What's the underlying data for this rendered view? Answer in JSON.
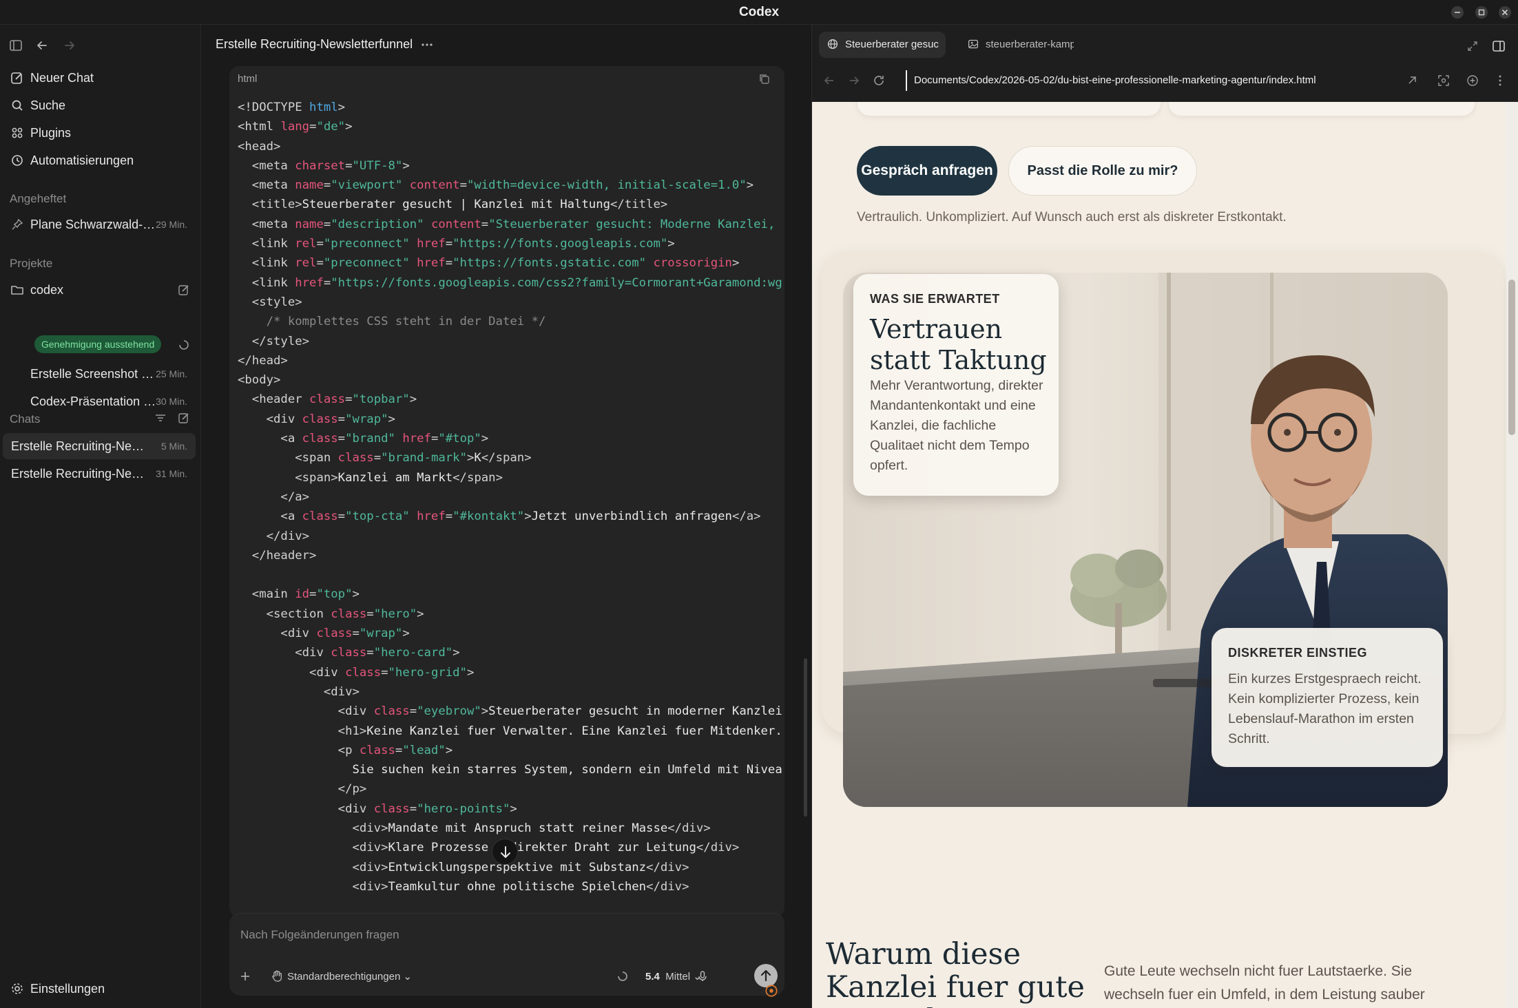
{
  "app": {
    "title": "Codex"
  },
  "sidebar": {
    "nav": [
      {
        "label": "Neuer Chat",
        "icon": "new-chat-icon"
      },
      {
        "label": "Suche",
        "icon": "search-icon"
      },
      {
        "label": "Plugins",
        "icon": "plugins-icon"
      },
      {
        "label": "Automatisierungen",
        "icon": "clock-icon"
      }
    ],
    "pinned_heading": "Angeheftet",
    "pinned": [
      {
        "label": "Plane Schwarzwald-…",
        "time": "29 Min."
      }
    ],
    "projects_heading": "Projekte",
    "project": {
      "label": "codex",
      "badge": "Genehmigung ausstehend"
    },
    "project_items": [
      {
        "label": "Erstelle Screenshot …",
        "time": "25 Min."
      },
      {
        "label": "Codex-Präsentation …",
        "time": "30 Min."
      }
    ],
    "chats_heading": "Chats",
    "chats": [
      {
        "label": "Erstelle Recruiting-Ne…",
        "time": "5 Min."
      },
      {
        "label": "Erstelle Recruiting-Ne…",
        "time": "31 Min."
      }
    ],
    "settings_label": "Einstellungen"
  },
  "chat": {
    "title": "Erstelle Recruiting-Newsletterfunnel",
    "code_lang": "html",
    "composer_placeholder": "Nach Folgeänderungen fragen",
    "permissions_label": "Standardberechtigungen",
    "model_label": "5.4",
    "effort_label": "Mittel"
  },
  "code_lines": [
    [
      [
        "p",
        "<!DOCTYPE "
      ],
      [
        "k",
        "html"
      ],
      [
        "p",
        ">"
      ]
    ],
    [
      [
        "p",
        "<html "
      ],
      [
        "a",
        "lang"
      ],
      [
        "p",
        "="
      ],
      [
        "s",
        "\"de\""
      ],
      [
        "p",
        ">"
      ]
    ],
    [
      [
        "p",
        "<head>"
      ]
    ],
    [
      [
        "p",
        "  <meta "
      ],
      [
        "a",
        "charset"
      ],
      [
        "p",
        "="
      ],
      [
        "s",
        "\"UTF-8\""
      ],
      [
        "p",
        ">"
      ]
    ],
    [
      [
        "p",
        "  <meta "
      ],
      [
        "a",
        "name"
      ],
      [
        "p",
        "="
      ],
      [
        "s",
        "\"viewport\""
      ],
      [
        "p",
        " "
      ],
      [
        "a",
        "content"
      ],
      [
        "p",
        "="
      ],
      [
        "s",
        "\"width=device-width, initial-scale=1.0\""
      ],
      [
        "p",
        ">"
      ]
    ],
    [
      [
        "p",
        "  <title>"
      ],
      [
        "t",
        "Steuerberater gesucht | Kanzlei mit Haltung"
      ],
      [
        "p",
        "</title>"
      ]
    ],
    [
      [
        "p",
        "  <meta "
      ],
      [
        "a",
        "name"
      ],
      [
        "p",
        "="
      ],
      [
        "s",
        "\"description\""
      ],
      [
        "p",
        " "
      ],
      [
        "a",
        "content"
      ],
      [
        "p",
        "="
      ],
      [
        "s",
        "\"Steuerberater gesucht: Moderne Kanzlei,"
      ]
    ],
    [
      [
        "p",
        "  <link "
      ],
      [
        "a",
        "rel"
      ],
      [
        "p",
        "="
      ],
      [
        "s",
        "\"preconnect\""
      ],
      [
        "p",
        " "
      ],
      [
        "a",
        "href"
      ],
      [
        "p",
        "="
      ],
      [
        "s",
        "\"https://fonts.googleapis.com\""
      ],
      [
        "p",
        ">"
      ]
    ],
    [
      [
        "p",
        "  <link "
      ],
      [
        "a",
        "rel"
      ],
      [
        "p",
        "="
      ],
      [
        "s",
        "\"preconnect\""
      ],
      [
        "p",
        " "
      ],
      [
        "a",
        "href"
      ],
      [
        "p",
        "="
      ],
      [
        "s",
        "\"https://fonts.gstatic.com\""
      ],
      [
        "p",
        " "
      ],
      [
        "a",
        "crossorigin"
      ],
      [
        "p",
        ">"
      ]
    ],
    [
      [
        "p",
        "  <link "
      ],
      [
        "a",
        "href"
      ],
      [
        "p",
        "="
      ],
      [
        "s",
        "\"https://fonts.googleapis.com/css2?family=Cormorant+Garamond:wg"
      ]
    ],
    [
      [
        "p",
        "  <style>"
      ]
    ],
    [
      [
        "c",
        "    /* komplettes CSS steht in der Datei */"
      ]
    ],
    [
      [
        "p",
        "  </style>"
      ]
    ],
    [
      [
        "p",
        "</head>"
      ]
    ],
    [
      [
        "p",
        "<body>"
      ]
    ],
    [
      [
        "p",
        "  <header "
      ],
      [
        "a",
        "class"
      ],
      [
        "p",
        "="
      ],
      [
        "s",
        "\"topbar\""
      ],
      [
        "p",
        ">"
      ]
    ],
    [
      [
        "p",
        "    <div "
      ],
      [
        "a",
        "class"
      ],
      [
        "p",
        "="
      ],
      [
        "s",
        "\"wrap\""
      ],
      [
        "p",
        ">"
      ]
    ],
    [
      [
        "p",
        "      <a "
      ],
      [
        "a",
        "class"
      ],
      [
        "p",
        "="
      ],
      [
        "s",
        "\"brand\""
      ],
      [
        "p",
        " "
      ],
      [
        "a",
        "href"
      ],
      [
        "p",
        "="
      ],
      [
        "s",
        "\"#top\""
      ],
      [
        "p",
        ">"
      ]
    ],
    [
      [
        "p",
        "        <span "
      ],
      [
        "a",
        "class"
      ],
      [
        "p",
        "="
      ],
      [
        "s",
        "\"brand-mark\""
      ],
      [
        "p",
        ">"
      ],
      [
        "t",
        "K"
      ],
      [
        "p",
        "</span>"
      ]
    ],
    [
      [
        "p",
        "        <span>"
      ],
      [
        "t",
        "Kanzlei am Markt"
      ],
      [
        "p",
        "</span>"
      ]
    ],
    [
      [
        "p",
        "      </a>"
      ]
    ],
    [
      [
        "p",
        "      <a "
      ],
      [
        "a",
        "class"
      ],
      [
        "p",
        "="
      ],
      [
        "s",
        "\"top-cta\""
      ],
      [
        "p",
        " "
      ],
      [
        "a",
        "href"
      ],
      [
        "p",
        "="
      ],
      [
        "s",
        "\"#kontakt\""
      ],
      [
        "p",
        ">"
      ],
      [
        "t",
        "Jetzt unverbindlich anfragen"
      ],
      [
        "p",
        "</a>"
      ]
    ],
    [
      [
        "p",
        "    </div>"
      ]
    ],
    [
      [
        "p",
        "  </header>"
      ]
    ],
    [
      [
        "p",
        ""
      ]
    ],
    [
      [
        "p",
        "  <main "
      ],
      [
        "a",
        "id"
      ],
      [
        "p",
        "="
      ],
      [
        "s",
        "\"top\""
      ],
      [
        "p",
        ">"
      ]
    ],
    [
      [
        "p",
        "    <section "
      ],
      [
        "a",
        "class"
      ],
      [
        "p",
        "="
      ],
      [
        "s",
        "\"hero\""
      ],
      [
        "p",
        ">"
      ]
    ],
    [
      [
        "p",
        "      <div "
      ],
      [
        "a",
        "class"
      ],
      [
        "p",
        "="
      ],
      [
        "s",
        "\"wrap\""
      ],
      [
        "p",
        ">"
      ]
    ],
    [
      [
        "p",
        "        <div "
      ],
      [
        "a",
        "class"
      ],
      [
        "p",
        "="
      ],
      [
        "s",
        "\"hero-card\""
      ],
      [
        "p",
        ">"
      ]
    ],
    [
      [
        "p",
        "          <div "
      ],
      [
        "a",
        "class"
      ],
      [
        "p",
        "="
      ],
      [
        "s",
        "\"hero-grid\""
      ],
      [
        "p",
        ">"
      ]
    ],
    [
      [
        "p",
        "            <div>"
      ]
    ],
    [
      [
        "p",
        "              <div "
      ],
      [
        "a",
        "class"
      ],
      [
        "p",
        "="
      ],
      [
        "s",
        "\"eyebrow\""
      ],
      [
        "p",
        ">"
      ],
      [
        "t",
        "Steuerberater gesucht in moderner Kanzlei"
      ]
    ],
    [
      [
        "p",
        "              <h1>"
      ],
      [
        "t",
        "Keine Kanzlei fuer Verwalter. Eine Kanzlei fuer Mitdenker."
      ]
    ],
    [
      [
        "p",
        "              <p "
      ],
      [
        "a",
        "class"
      ],
      [
        "p",
        "="
      ],
      [
        "s",
        "\"lead\""
      ],
      [
        "p",
        ">"
      ]
    ],
    [
      [
        "t",
        "                Sie suchen kein starres System, sondern ein Umfeld mit Nivea"
      ]
    ],
    [
      [
        "p",
        "              </p>"
      ]
    ],
    [
      [
        "p",
        "              <div "
      ],
      [
        "a",
        "class"
      ],
      [
        "p",
        "="
      ],
      [
        "s",
        "\"hero-points\""
      ],
      [
        "p",
        ">"
      ]
    ],
    [
      [
        "p",
        "                <div>"
      ],
      [
        "t",
        "Mandate mit Anspruch statt reiner Masse"
      ],
      [
        "p",
        "</div>"
      ]
    ],
    [
      [
        "p",
        "                <div>"
      ],
      [
        "t",
        "Klare Prozesse   direkter Draht zur Leitung"
      ],
      [
        "p",
        "</div>"
      ]
    ],
    [
      [
        "p",
        "                <div>"
      ],
      [
        "t",
        "Entwicklungsperspektive mit Substanz"
      ],
      [
        "p",
        "</div>"
      ]
    ],
    [
      [
        "p",
        "                <div>"
      ],
      [
        "t",
        "Teamkultur ohne politische Spielchen"
      ],
      [
        "p",
        "</div>"
      ]
    ]
  ],
  "browser": {
    "tabs": [
      {
        "label": "Steuerberater gesuc"
      },
      {
        "label": "steuerberater-kamp"
      }
    ],
    "url": "Documents/Codex/2026-05-02/du-bist-eine-professionelle-marketing-agentur/index.html"
  },
  "page": {
    "cta_primary": "Gespräch anfragen",
    "cta_secondary": "Passt die Rolle zu mir?",
    "hero_note": "Vertraulich. Unkompliziert. Auf Wunsch auch erst als diskreter Erstkontakt.",
    "card_expect": {
      "eyebrow": "WAS SIE ERWARTET",
      "heading": "Vertrauen statt Taktung",
      "text": "Mehr Verantwortung, direkter Mandantenkontakt und eine Kanzlei, die fachliche Qualitaet nicht dem Tempo opfert."
    },
    "card_start": {
      "eyebrow": "DISKRETER EINSTIEG",
      "text": "Ein kurzes Erstgespraech reicht. Kein komplizierter Prozess, kein Lebenslauf-Marathon im ersten Schritt."
    },
    "why_heading": "Warum diese Kanzlei fuer gute Steuerberater",
    "why_text": "Gute Leute wechseln nicht fuer Lautstaerke. Sie wechseln fuer ein Umfeld, in dem Leistung sauber organisiert ist,"
  }
}
